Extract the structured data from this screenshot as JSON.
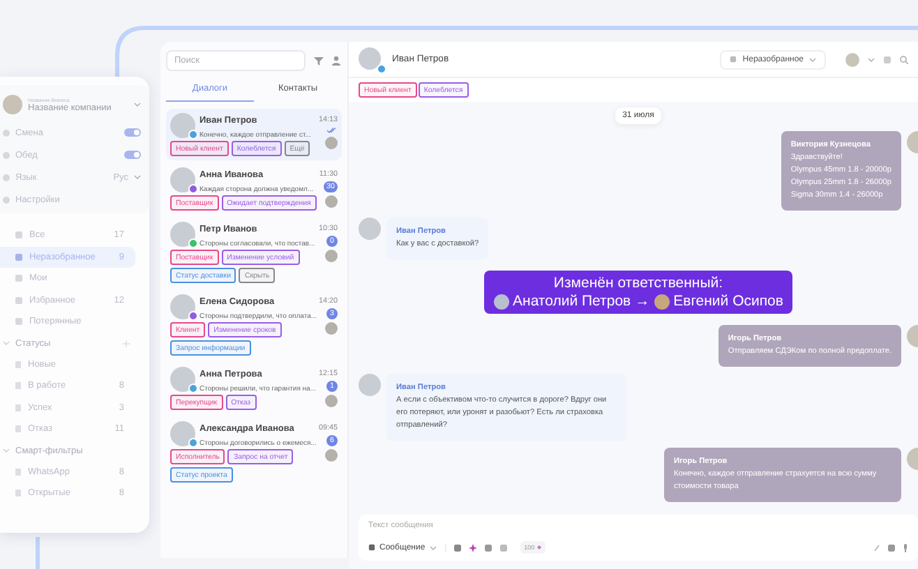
{
  "sidebar": {
    "company_caption": "Название бизнеса",
    "company": "Название компании",
    "toggles": [
      {
        "label": "Смена",
        "on": true
      },
      {
        "label": "Обед",
        "on": true
      }
    ],
    "language": {
      "label": "Язык",
      "value": "Рус"
    },
    "settings": "Настройки",
    "folders": [
      {
        "label": "Все",
        "count": "17",
        "selected": false
      },
      {
        "label": "Неразобранное",
        "count": "9",
        "selected": true
      },
      {
        "label": "Мои",
        "selected": false
      },
      {
        "label": "Избранное",
        "count": "12",
        "selected": false
      },
      {
        "label": "Потерянные",
        "selected": false
      }
    ],
    "sections": [
      {
        "title": "Статусы",
        "expanded": true,
        "items": [
          {
            "label": "Новые"
          },
          {
            "label": "В работе",
            "count": "8"
          },
          {
            "label": "Успех",
            "count": "3"
          },
          {
            "label": "Отказ",
            "count": "11"
          }
        ]
      },
      {
        "title": "Смарт-фильтры",
        "expanded": true,
        "items": [
          {
            "label": "WhatsApp",
            "count": "8"
          },
          {
            "label": "Открытые",
            "count": "8"
          }
        ]
      }
    ]
  },
  "chat_list": {
    "search": {
      "placeholder": "Поиск"
    },
    "tabs": [
      {
        "label": "Диалоги",
        "selected": true
      },
      {
        "label": "Контакты",
        "selected": false
      }
    ],
    "chats": [
      {
        "name": "Иван Петров",
        "time": "14:13",
        "preview": "Конечно, каждое отправление ст...",
        "selected": true,
        "kind": "telegram",
        "tags": [
          {
            "label": "Новый клиент",
            "color": "#e8488a"
          },
          {
            "label": "Колеблется",
            "color": "#9b5de5"
          },
          {
            "label": "Ещё",
            "color": "#888888"
          }
        ]
      },
      {
        "name": "Анна Иванова",
        "time": "11:30",
        "preview": "Каждая сторона должна уведомл...",
        "unread": "30",
        "selected": false,
        "kind": "viber",
        "tags": [
          {
            "label": "Поставщик",
            "color": "#e8488a"
          },
          {
            "label": "Ожидает подтверждения",
            "color": "#9b5de5"
          }
        ]
      },
      {
        "name": "Петр Иванов",
        "time": "10:30",
        "preview": "Стороны согласовали, что постав...",
        "unread": "0",
        "selected": false,
        "kind": "whatsapp",
        "tags": [
          {
            "label": "Поставщик",
            "color": "#e8488a"
          },
          {
            "label": "Изменение условий",
            "color": "#9b5de5"
          },
          {
            "label": "Статус доставки",
            "color": "#4a90e2"
          },
          {
            "label": "Скрыть",
            "color": "#888888"
          }
        ]
      },
      {
        "name": "Елена Сидорова",
        "time": "14:20",
        "preview": "Стороны подтвердили, что оплата...",
        "unread": "3",
        "selected": false,
        "kind": "viber",
        "tags": [
          {
            "label": "Клиент",
            "color": "#e8488a"
          },
          {
            "label": "Изменение сроков",
            "color": "#9b5de5"
          },
          {
            "label": "Запрос информации",
            "color": "#4a90e2"
          }
        ]
      },
      {
        "name": "Анна Петрова",
        "time": "12:15",
        "preview": "Стороны решили, что гарантия на...",
        "unread": "1",
        "selected": false,
        "kind": "telegram",
        "tags": [
          {
            "label": "Перекупщик",
            "color": "#e8488a"
          },
          {
            "label": "Отказ",
            "color": "#9b5de5"
          }
        ]
      },
      {
        "name": "Александра Иванова",
        "time": "09:45",
        "preview": "Стороны договорились о ежемеся...",
        "unread": "6",
        "selected": false,
        "kind": "telegram",
        "tags": [
          {
            "label": "Исполнитель",
            "color": "#e8488a"
          },
          {
            "label": "Запрос на отчет",
            "color": "#9b5de5"
          },
          {
            "label": "Статус проекта",
            "color": "#4a90e2"
          }
        ]
      }
    ]
  },
  "chat": {
    "name": "Иван Петров",
    "folder": "Неразобранное",
    "tags": [
      {
        "label": "Новый клиент",
        "color": "#e8488a"
      },
      {
        "label": "Колеблется",
        "color": "#9b5de5"
      }
    ],
    "date": "31 июля",
    "messages": [
      {
        "kind": "out",
        "author": "Виктория Кузнецова",
        "text": "Здравствуйте!\nOlympus 45mm 1.8 - 20000р\nOlympus 25mm 1.8 - 26000р\nSigma 30mm 1.4 - 26000р"
      },
      {
        "kind": "in",
        "author": "Иван Петров",
        "text": "Как у вас с доставкой?"
      },
      {
        "kind": "system",
        "title": "Изменён ответственный:",
        "from": "Анатолий Петров",
        "arrow": "→",
        "to": "Евгений Осипов"
      },
      {
        "kind": "out",
        "author": "Игорь Петров",
        "text": "Отправляем СДЭКом по полной предоплате."
      },
      {
        "kind": "in",
        "author": "Иван Петров",
        "text": "А если с объективом что-то случится в дороге? Вдруг они его потеряют, или уронят и разобьют? Есть ли страховка отправлений?"
      },
      {
        "kind": "out",
        "author": "Игорь Петров",
        "text": "Конечно, каждое отправление страхуется на всю сумму стоимости товара"
      }
    ],
    "composer": {
      "placeholder": "Текст сообщения",
      "mode": "Сообщение",
      "counter": "100"
    }
  }
}
